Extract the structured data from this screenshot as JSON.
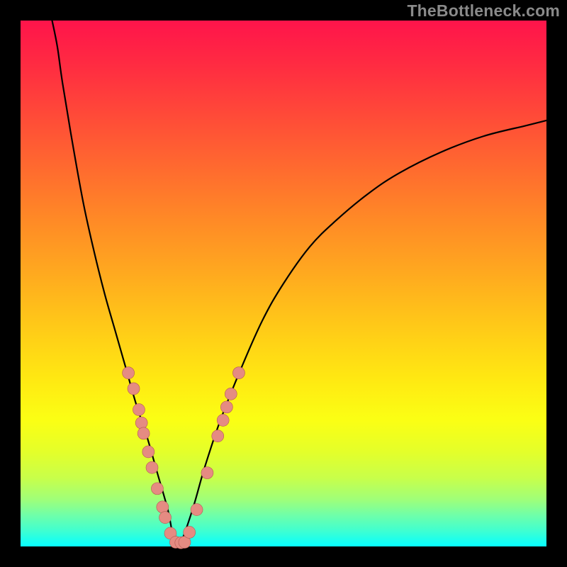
{
  "watermark": "TheBottleneck.com",
  "colors": {
    "frame": "#000000",
    "curve": "#000000",
    "dot_fill": "#e58b82",
    "dot_stroke": "#b35a52"
  },
  "chart_data": {
    "type": "line",
    "title": "",
    "xlabel": "",
    "ylabel": "",
    "xlim": [
      0,
      100
    ],
    "ylim": [
      0,
      100
    ],
    "x_min_at": 30,
    "series": [
      {
        "name": "left-branch",
        "x": [
          6,
          7,
          8,
          10,
          12,
          14,
          16,
          18,
          20,
          22,
          24,
          26,
          28,
          29,
          30
        ],
        "y": [
          100,
          95,
          88,
          76,
          65,
          56,
          48,
          41,
          34,
          27,
          21,
          14,
          7,
          2,
          0
        ]
      },
      {
        "name": "right-branch",
        "x": [
          30,
          31,
          33,
          35,
          38,
          42,
          46,
          50,
          55,
          60,
          66,
          72,
          80,
          88,
          96,
          100
        ],
        "y": [
          0,
          2,
          8,
          15,
          24,
          34,
          43,
          50,
          57,
          62,
          67,
          71,
          75,
          78,
          80,
          81
        ]
      }
    ],
    "points": [
      {
        "x": 20.5,
        "y": 33
      },
      {
        "x": 21.5,
        "y": 30
      },
      {
        "x": 22.5,
        "y": 26
      },
      {
        "x": 23.0,
        "y": 23.5
      },
      {
        "x": 23.4,
        "y": 21.5
      },
      {
        "x": 24.3,
        "y": 18
      },
      {
        "x": 25.0,
        "y": 15
      },
      {
        "x": 26.0,
        "y": 11
      },
      {
        "x": 27.0,
        "y": 7.5
      },
      {
        "x": 27.5,
        "y": 5.5
      },
      {
        "x": 28.5,
        "y": 2.5
      },
      {
        "x": 29.5,
        "y": 0.8
      },
      {
        "x": 30.5,
        "y": 0.7
      },
      {
        "x": 31.2,
        "y": 0.8
      },
      {
        "x": 32.1,
        "y": 2.7
      },
      {
        "x": 33.5,
        "y": 7
      },
      {
        "x": 35.5,
        "y": 14
      },
      {
        "x": 37.5,
        "y": 21
      },
      {
        "x": 38.5,
        "y": 24
      },
      {
        "x": 39.2,
        "y": 26.5
      },
      {
        "x": 40.0,
        "y": 29
      },
      {
        "x": 41.5,
        "y": 33
      }
    ],
    "notes": "V-shaped bottleneck curve on rainbow gradient background. Minimum (0) occurs near x≈30. Salmon dots mark sampled points along the lower portion of both branches."
  }
}
